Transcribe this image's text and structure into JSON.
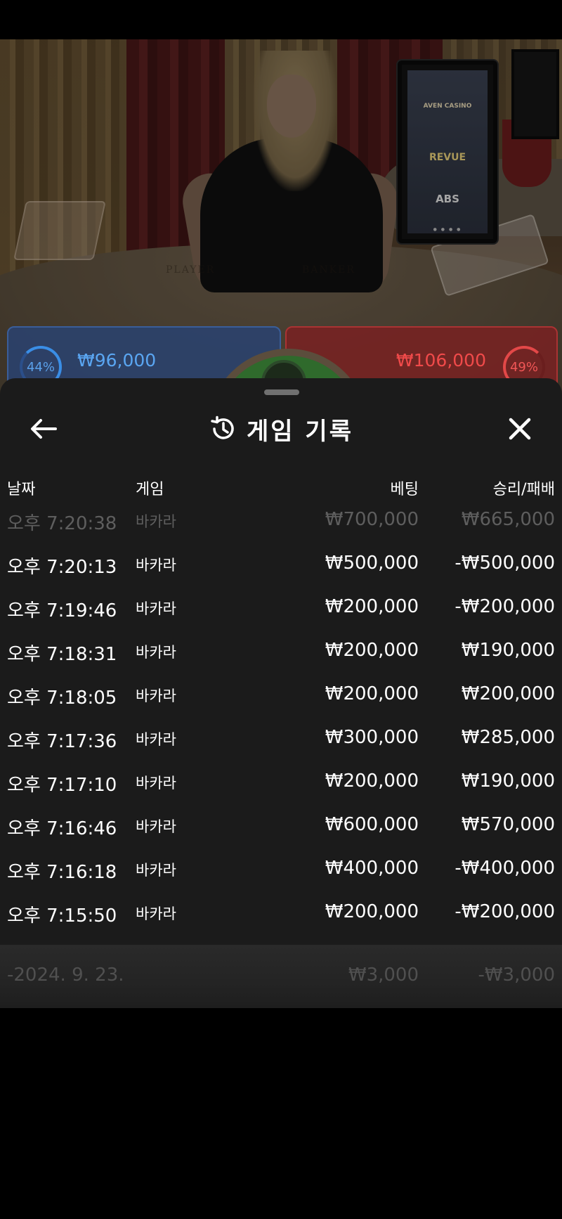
{
  "video": {
    "sign_brands": [
      "AVEN CASINO",
      "REVUE",
      "ABS"
    ],
    "felt_labels": [
      "PLAYER",
      "BANKER"
    ]
  },
  "bets": {
    "player": {
      "percent": "44%",
      "amount": "₩96,000"
    },
    "banker": {
      "percent": "49%",
      "amount": "₩106,000"
    }
  },
  "sheet": {
    "title": "게임 기록",
    "icons": {
      "back": "back-arrow-icon",
      "history": "history-icon",
      "close": "close-icon"
    },
    "columns": {
      "date": "날짜",
      "game": "게임",
      "bet": "베팅",
      "win_loss": "승리/패배"
    },
    "rows": [
      {
        "time": "오후 7:20:38",
        "game": "바카라",
        "bet": "₩700,000",
        "win_loss": "₩665,000"
      },
      {
        "time": "오후 7:20:13",
        "game": "바카라",
        "bet": "₩500,000",
        "win_loss": "-₩500,000"
      },
      {
        "time": "오후 7:19:46",
        "game": "바카라",
        "bet": "₩200,000",
        "win_loss": "-₩200,000"
      },
      {
        "time": "오후 7:18:31",
        "game": "바카라",
        "bet": "₩200,000",
        "win_loss": "₩190,000"
      },
      {
        "time": "오후 7:18:05",
        "game": "바카라",
        "bet": "₩200,000",
        "win_loss": "₩200,000"
      },
      {
        "time": "오후 7:17:36",
        "game": "바카라",
        "bet": "₩300,000",
        "win_loss": "₩285,000"
      },
      {
        "time": "오후 7:17:10",
        "game": "바카라",
        "bet": "₩200,000",
        "win_loss": "₩190,000"
      },
      {
        "time": "오후 7:16:46",
        "game": "바카라",
        "bet": "₩600,000",
        "win_loss": "₩570,000"
      },
      {
        "time": "오후 7:16:18",
        "game": "바카라",
        "bet": "₩400,000",
        "win_loss": "-₩400,000"
      },
      {
        "time": "오후 7:15:50",
        "game": "바카라",
        "bet": "₩200,000",
        "win_loss": "-₩200,000"
      }
    ],
    "summary": {
      "date": "-2024. 9. 23.",
      "bet": "₩3,000",
      "win_loss": "-₩3,000"
    }
  }
}
